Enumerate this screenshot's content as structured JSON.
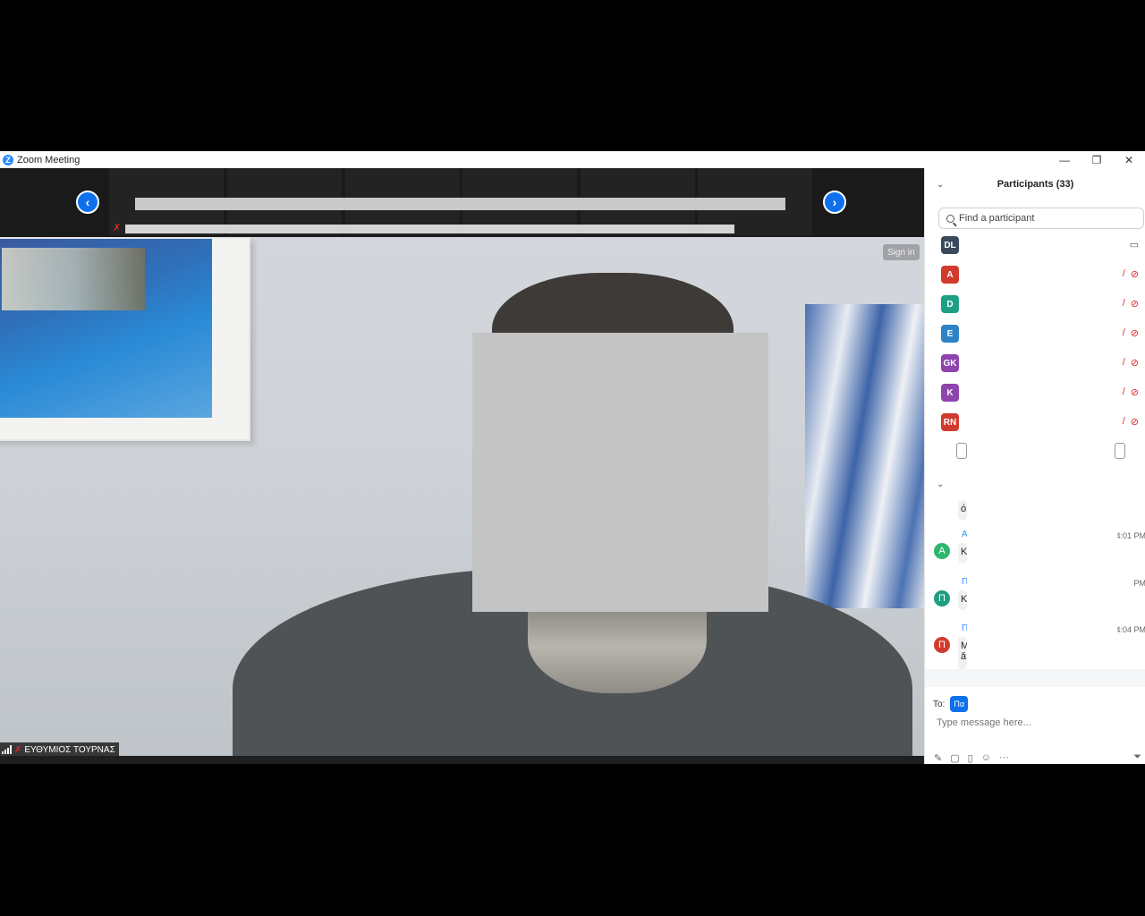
{
  "window": {
    "title": "Zoom Meeting",
    "logo_letter": "Z",
    "controls": [
      "—",
      "❐",
      "✕"
    ]
  },
  "meeting": {
    "strip_nav_prev": "‹",
    "strip_nav_next": "›",
    "signin_badge": "Sign in",
    "speaker_name": "ΕΥΘΥΜΙΟΣ ΤΟΥΡΝΑΣ",
    "muted_glyph": "✗"
  },
  "participants": {
    "title": "Participants (33)",
    "search_placeholder": "Find a participant",
    "items": [
      {
        "initials": "DL",
        "color": "#3a4a5c",
        "mic": "",
        "video": "▭",
        "video_on": true
      },
      {
        "initials": "A",
        "color": "#d13b2e",
        "mic": "/",
        "video": "⊘"
      },
      {
        "initials": "D",
        "color": "#1e9e82",
        "mic": "/",
        "video": "⊘"
      },
      {
        "initials": "E",
        "color": "#2d83c6",
        "mic": "/",
        "video": "⊘"
      },
      {
        "initials": "GK",
        "color": "#8e44ad",
        "mic": "/",
        "video": "⊘"
      },
      {
        "initials": "K",
        "color": "#8e44ad",
        "mic": "/",
        "video": "⊘"
      },
      {
        "initials": "RN",
        "color": "#d13b2e",
        "mic": "/",
        "video": "⊘"
      }
    ]
  },
  "chat": {
    "messages": [
      {
        "avatar": "",
        "avatar_color": "",
        "sender": "",
        "bubble": "ό",
        "time": ""
      },
      {
        "avatar": "A",
        "avatar_color": "#2fb66e",
        "sender": "A",
        "bubble": "K",
        "time": "4:01 PM"
      },
      {
        "avatar": "Π",
        "avatar_color": "#1e9e82",
        "sender": "Π",
        "bubble": "K",
        "time": "PM"
      },
      {
        "avatar": "Π",
        "avatar_color": "#d13b2e",
        "sender": "Π",
        "bubble": "M ǎ",
        "time": "4:04 PM"
      }
    ],
    "to_label": "To:",
    "to_chip": "Πα",
    "input_placeholder": "Type message here...",
    "tools": [
      "✎",
      "▢",
      "▯",
      "☺",
      "···"
    ],
    "more": "⏷"
  }
}
